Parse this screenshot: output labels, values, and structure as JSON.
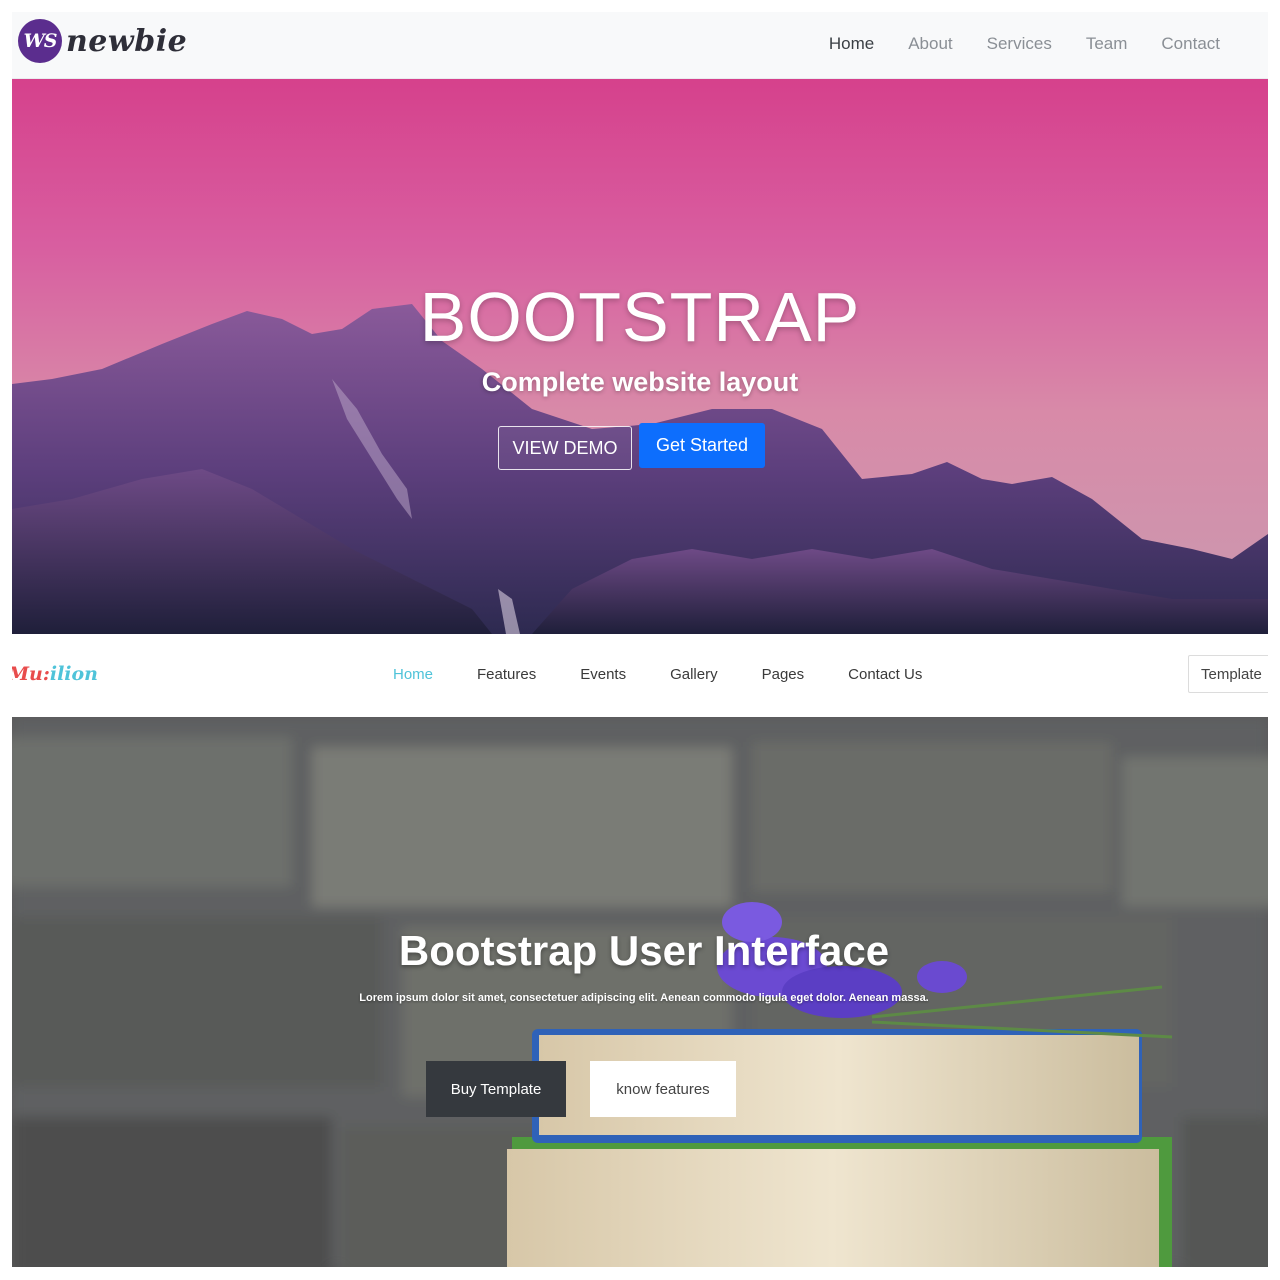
{
  "shot1": {
    "brand": {
      "mark": "WS",
      "name": "newbie"
    },
    "nav": [
      {
        "label": "Home",
        "active": true
      },
      {
        "label": "About"
      },
      {
        "label": "Services"
      },
      {
        "label": "Team"
      },
      {
        "label": "Contact"
      }
    ],
    "hero": {
      "title": "BOOTSTRAP",
      "subtitle": "Complete website layout",
      "demo_button": "VIEW DEMO",
      "start_button": "Get Started"
    },
    "colors": {
      "primary": "#0d6efd",
      "sky_top": "#d6418c",
      "mountain": "#5b3d80"
    }
  },
  "shot2": {
    "brand": {
      "part1": "Mu:",
      "part2": "ilion"
    },
    "nav": [
      {
        "label": "Home",
        "active": true
      },
      {
        "label": "Features"
      },
      {
        "label": "Events"
      },
      {
        "label": "Gallery"
      },
      {
        "label": "Pages"
      },
      {
        "label": "Contact Us"
      }
    ],
    "template_button": "Template",
    "hero": {
      "title": "Bootstrap User Interface",
      "description": "Lorem ipsum dolor sit amet, consectetuer adipiscing elit. Aenean commodo ligula eget dolor. Aenean massa.",
      "buy_button": "Buy Template",
      "features_button": "know features"
    },
    "colors": {
      "accent": "#4fc3d9",
      "dark_button": "#35393e"
    }
  }
}
